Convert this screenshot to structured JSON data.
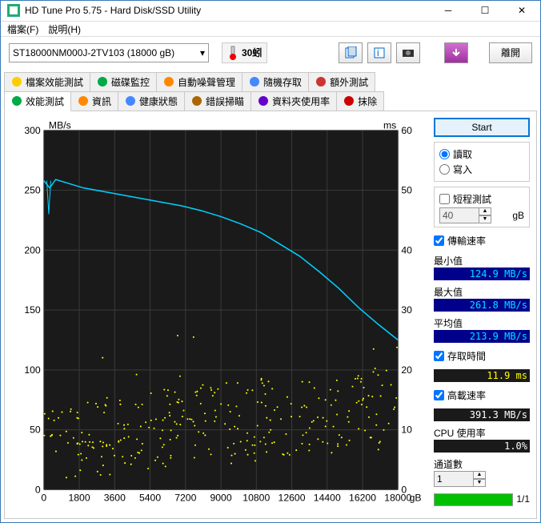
{
  "window": {
    "title": "HD Tune Pro 5.75 - Hard Disk/SSD Utility"
  },
  "menu": {
    "file": "檔案(F)",
    "help": "說明(H)"
  },
  "toolbar": {
    "drive": "ST18000NM000J-2TV103 (18000 gB)",
    "temp": "30蚓",
    "exit": "離開"
  },
  "tabs_top": [
    {
      "label": "檔案效能測試"
    },
    {
      "label": "磁碟監控"
    },
    {
      "label": "自動噪聲管理"
    },
    {
      "label": "隨機存取"
    },
    {
      "label": "額外測試"
    }
  ],
  "tabs_bottom": [
    {
      "label": "效能測試",
      "active": true
    },
    {
      "label": "資訊"
    },
    {
      "label": "健康狀態"
    },
    {
      "label": "錯誤掃瞄"
    },
    {
      "label": "資料夾使用率"
    },
    {
      "label": "抹除"
    }
  ],
  "side": {
    "start": "Start",
    "read": "讀取",
    "write": "寫入",
    "short_test": "短程測試",
    "short_size": "40",
    "short_unit": "gB",
    "transfer": "傳輸速率",
    "min_l": "最小值",
    "min_v": "124.9 MB/s",
    "max_l": "最大值",
    "max_v": "261.8 MB/s",
    "avg_l": "平均值",
    "avg_v": "213.9 MB/s",
    "access": "存取時間",
    "access_v": "11.9 ms",
    "burst": "高載速率",
    "burst_v": "391.3 MB/s",
    "cpu": "CPU 使用率",
    "cpu_v": "1.0%",
    "channels": "通道數",
    "channels_v": "1",
    "progress": "1/1"
  },
  "chart_data": {
    "type": "line+scatter",
    "title": "",
    "x_unit": "gB",
    "xlim": [
      0,
      18000
    ],
    "xticks": [
      0,
      1800,
      3600,
      5400,
      7200,
      9000,
      10800,
      12600,
      14400,
      16200,
      18000
    ],
    "y_left": {
      "label": "MB/s",
      "lim": [
        0,
        300
      ],
      "ticks": [
        0,
        50,
        100,
        150,
        200,
        250,
        300
      ]
    },
    "y_right": {
      "label": "ms",
      "lim": [
        0,
        60
      ],
      "ticks": [
        0,
        10,
        20,
        30,
        40,
        50,
        60
      ]
    },
    "series": [
      {
        "name": "transfer_rate",
        "axis": "left",
        "type": "line",
        "color": "#00d0ff",
        "x": [
          0,
          300,
          600,
          1200,
          2000,
          3000,
          4000,
          5000,
          6000,
          7000,
          8000,
          9000,
          10000,
          11000,
          12000,
          13000,
          14000,
          15000,
          16000,
          17000,
          18000
        ],
        "y": [
          258,
          252,
          259,
          256,
          252,
          249,
          246,
          243,
          240,
          237,
          233,
          228,
          222,
          215,
          205,
          195,
          182,
          168,
          152,
          138,
          125
        ]
      },
      {
        "name": "access_time",
        "axis": "right",
        "type": "scatter",
        "color": "#ffff00",
        "x": [
          200,
          500,
          900,
          1300,
          1700,
          2100,
          2500,
          2900,
          3300,
          3700,
          4100,
          4500,
          4900,
          5300,
          5700,
          6100,
          6500,
          6900,
          7300,
          7700,
          8100,
          8500,
          8900,
          9300,
          9700,
          10100,
          10500,
          10900,
          11300,
          11700,
          12100,
          12500,
          12900,
          13300,
          13700,
          14100,
          14500,
          14900,
          15300,
          15700,
          16100,
          16500,
          16900,
          17300,
          17700
        ],
        "y_approx": "scattered 5-24 ms, mean~12"
      }
    ]
  }
}
